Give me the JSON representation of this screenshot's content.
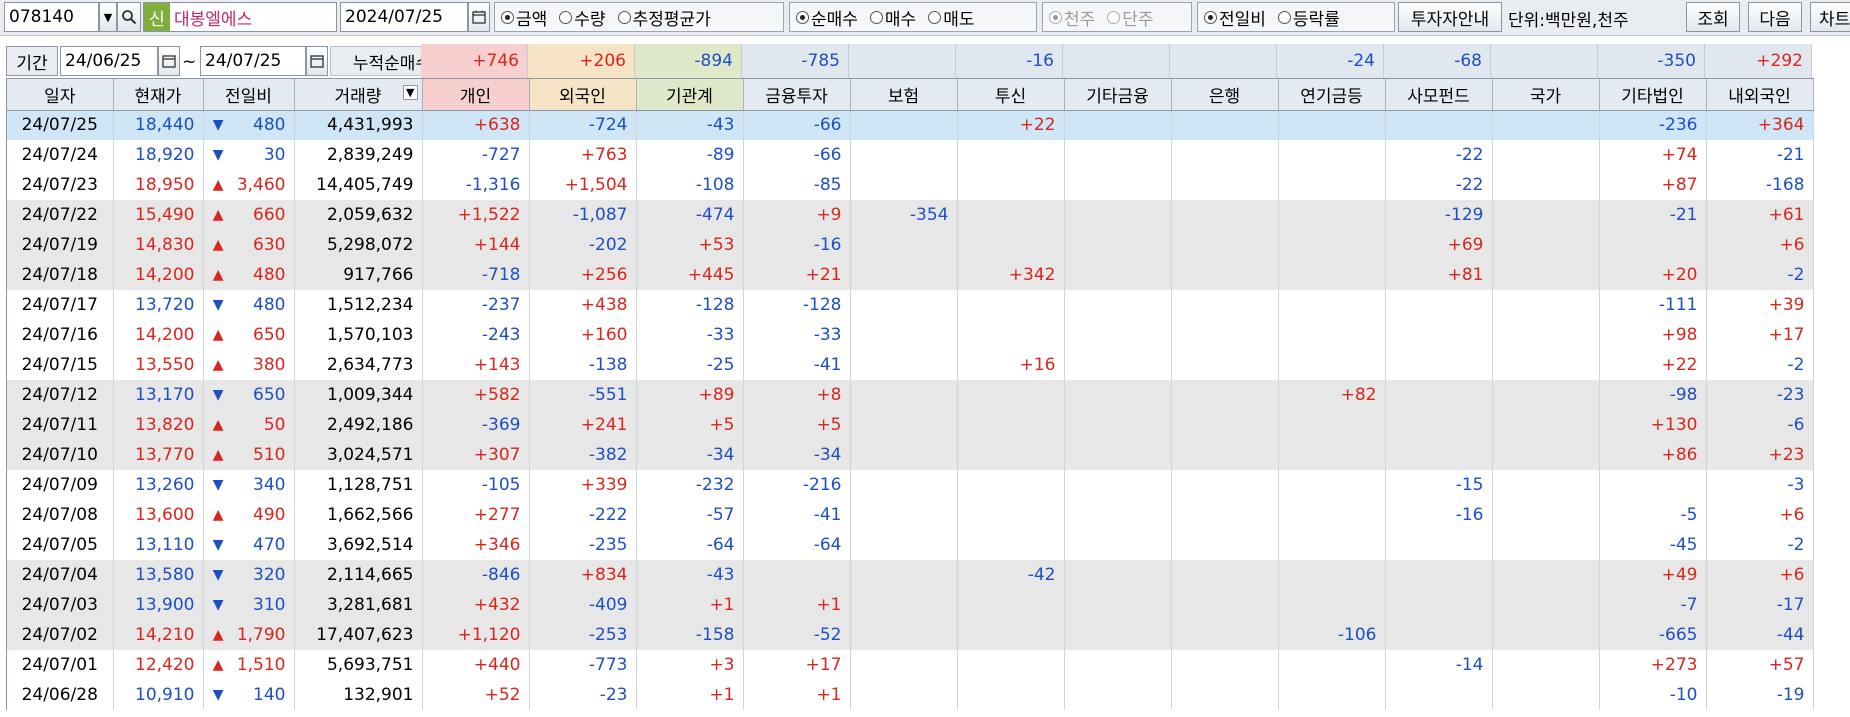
{
  "toolbar": {
    "code": "078140",
    "badge": "신",
    "name": "대봉엘에스",
    "date": "2024/07/25",
    "radio_group1": [
      {
        "label": "금액",
        "selected": true
      },
      {
        "label": "수량",
        "selected": false
      },
      {
        "label": "추정평균가",
        "selected": false
      }
    ],
    "radio_group2": [
      {
        "label": "순매수",
        "selected": true
      },
      {
        "label": "매수",
        "selected": false
      },
      {
        "label": "매도",
        "selected": false
      }
    ],
    "radio_group3": [
      {
        "label": "천주",
        "selected": true
      },
      {
        "label": "단주",
        "selected": false
      }
    ],
    "radio_group4": [
      {
        "label": "전일비",
        "selected": true
      },
      {
        "label": "등락률",
        "selected": false
      }
    ],
    "investor_guide_btn": "투자자안내",
    "unit_label": "단위:백만원,천주",
    "search_btn": "조회",
    "next_btn": "다음",
    "chart_btn": "차트"
  },
  "period": {
    "label": "기간",
    "from": "24/06/25",
    "tilde": "~",
    "to": "24/07/25",
    "cum_label": "누적순매수",
    "cum_values": [
      "+746",
      "+206",
      "-894",
      "-785",
      "",
      "-16",
      "",
      "",
      "-24",
      "-68",
      "",
      "-350",
      "+292"
    ]
  },
  "colors": {
    "up": "#d9261c",
    "down": "#1c4fc4",
    "personal_bg": "#f8cfcf",
    "foreign_bg": "#f7e4c6",
    "inst_bg": "#dfe8c8",
    "header_bg": "#e4eaf1",
    "selected_row": "#cfe6f6",
    "alt_row": "#e7e7e7"
  },
  "columns": [
    "일자",
    "현재가",
    "전일비",
    "거래량",
    "개인",
    "외국인",
    "기관계",
    "금융투자",
    "보험",
    "투신",
    "기타금융",
    "은행",
    "연기금등",
    "사모펀드",
    "국가",
    "기타법인",
    "내외국인"
  ],
  "rows": [
    {
      "date": "24/07/25",
      "price": "18,440",
      "dir": "dn",
      "chg": "480",
      "vol": "4,431,993",
      "v": [
        "+638",
        "-724",
        "-43",
        "-66",
        "",
        "+22",
        "",
        "",
        "",
        "",
        "",
        "-236",
        "+364"
      ]
    },
    {
      "date": "24/07/24",
      "price": "18,920",
      "dir": "dn",
      "chg": "30",
      "vol": "2,839,249",
      "v": [
        "-727",
        "+763",
        "-89",
        "-66",
        "",
        "",
        "",
        "",
        "",
        "-22",
        "",
        "+74",
        "-21"
      ]
    },
    {
      "date": "24/07/23",
      "price": "18,950",
      "dir": "up",
      "chg": "3,460",
      "vol": "14,405,749",
      "v": [
        "-1,316",
        "+1,504",
        "-108",
        "-85",
        "",
        "",
        "",
        "",
        "",
        "-22",
        "",
        "+87",
        "-168"
      ]
    },
    {
      "date": "24/07/22",
      "price": "15,490",
      "dir": "up",
      "chg": "660",
      "vol": "2,059,632",
      "v": [
        "+1,522",
        "-1,087",
        "-474",
        "+9",
        "-354",
        "",
        "",
        "",
        "",
        "-129",
        "",
        "-21",
        "+61"
      ]
    },
    {
      "date": "24/07/19",
      "price": "14,830",
      "dir": "up",
      "chg": "630",
      "vol": "5,298,072",
      "v": [
        "+144",
        "-202",
        "+53",
        "-16",
        "",
        "",
        "",
        "",
        "",
        "+69",
        "",
        "",
        "+6"
      ]
    },
    {
      "date": "24/07/18",
      "price": "14,200",
      "dir": "up",
      "chg": "480",
      "vol": "917,766",
      "v": [
        "-718",
        "+256",
        "+445",
        "+21",
        "",
        "+342",
        "",
        "",
        "",
        "+81",
        "",
        "+20",
        "-2"
      ]
    },
    {
      "date": "24/07/17",
      "price": "13,720",
      "dir": "dn",
      "chg": "480",
      "vol": "1,512,234",
      "v": [
        "-237",
        "+438",
        "-128",
        "-128",
        "",
        "",
        "",
        "",
        "",
        "",
        "",
        "-111",
        "+39"
      ]
    },
    {
      "date": "24/07/16",
      "price": "14,200",
      "dir": "up",
      "chg": "650",
      "vol": "1,570,103",
      "v": [
        "-243",
        "+160",
        "-33",
        "-33",
        "",
        "",
        "",
        "",
        "",
        "",
        "",
        "+98",
        "+17"
      ]
    },
    {
      "date": "24/07/15",
      "price": "13,550",
      "dir": "up",
      "chg": "380",
      "vol": "2,634,773",
      "v": [
        "+143",
        "-138",
        "-25",
        "-41",
        "",
        "+16",
        "",
        "",
        "",
        "",
        "",
        "+22",
        "-2"
      ]
    },
    {
      "date": "24/07/12",
      "price": "13,170",
      "dir": "dn",
      "chg": "650",
      "vol": "1,009,344",
      "v": [
        "+582",
        "-551",
        "+89",
        "+8",
        "",
        "",
        "",
        "",
        "+82",
        "",
        "",
        "-98",
        "-23"
      ]
    },
    {
      "date": "24/07/11",
      "price": "13,820",
      "dir": "up",
      "chg": "50",
      "vol": "2,492,186",
      "v": [
        "-369",
        "+241",
        "+5",
        "+5",
        "",
        "",
        "",
        "",
        "",
        "",
        "",
        "+130",
        "-6"
      ]
    },
    {
      "date": "24/07/10",
      "price": "13,770",
      "dir": "up",
      "chg": "510",
      "vol": "3,024,571",
      "v": [
        "+307",
        "-382",
        "-34",
        "-34",
        "",
        "",
        "",
        "",
        "",
        "",
        "",
        "+86",
        "+23"
      ]
    },
    {
      "date": "24/07/09",
      "price": "13,260",
      "dir": "dn",
      "chg": "340",
      "vol": "1,128,751",
      "v": [
        "-105",
        "+339",
        "-232",
        "-216",
        "",
        "",
        "",
        "",
        "",
        "-15",
        "",
        "",
        "-3"
      ]
    },
    {
      "date": "24/07/08",
      "price": "13,600",
      "dir": "up",
      "chg": "490",
      "vol": "1,662,566",
      "v": [
        "+277",
        "-222",
        "-57",
        "-41",
        "",
        "",
        "",
        "",
        "",
        "-16",
        "",
        "-5",
        "+6"
      ]
    },
    {
      "date": "24/07/05",
      "price": "13,110",
      "dir": "dn",
      "chg": "470",
      "vol": "3,692,514",
      "v": [
        "+346",
        "-235",
        "-64",
        "-64",
        "",
        "",
        "",
        "",
        "",
        "",
        "",
        "-45",
        "-2"
      ]
    },
    {
      "date": "24/07/04",
      "price": "13,580",
      "dir": "dn",
      "chg": "320",
      "vol": "2,114,665",
      "v": [
        "-846",
        "+834",
        "-43",
        "",
        "",
        "-42",
        "",
        "",
        "",
        "",
        "",
        "+49",
        "+6"
      ]
    },
    {
      "date": "24/07/03",
      "price": "13,900",
      "dir": "dn",
      "chg": "310",
      "vol": "3,281,681",
      "v": [
        "+432",
        "-409",
        "+1",
        "+1",
        "",
        "",
        "",
        "",
        "",
        "",
        "",
        "-7",
        "-17"
      ]
    },
    {
      "date": "24/07/02",
      "price": "14,210",
      "dir": "up",
      "chg": "1,790",
      "vol": "17,407,623",
      "v": [
        "+1,120",
        "-253",
        "-158",
        "-52",
        "",
        "",
        "",
        "",
        "-106",
        "",
        "",
        "-665",
        "-44"
      ]
    },
    {
      "date": "24/07/01",
      "price": "12,420",
      "dir": "up",
      "chg": "1,510",
      "vol": "5,693,751",
      "v": [
        "+440",
        "-773",
        "+3",
        "+17",
        "",
        "",
        "",
        "",
        "",
        "-14",
        "",
        "+273",
        "+57"
      ]
    },
    {
      "date": "24/06/28",
      "price": "10,910",
      "dir": "dn",
      "chg": "140",
      "vol": "132,901",
      "v": [
        "+52",
        "-23",
        "+1",
        "+1",
        "",
        "",
        "",
        "",
        "",
        "",
        "",
        "-10",
        "-19"
      ]
    }
  ],
  "row_shading": [
    "sel",
    "",
    "",
    "alt",
    "alt",
    "alt",
    "",
    "",
    "",
    "alt",
    "alt",
    "alt",
    "",
    "",
    "",
    "alt",
    "alt",
    "alt",
    "",
    ""
  ],
  "icons": {
    "dropdown": "chevron-down-icon",
    "search": "search-icon",
    "calendar": "calendar-icon",
    "up": "triangle-up-icon",
    "down": "triangle-down-icon"
  }
}
